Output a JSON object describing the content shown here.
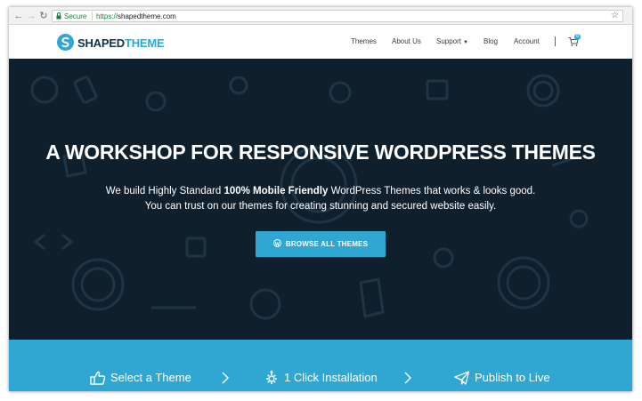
{
  "browser": {
    "secure_label": "Secure",
    "url_scheme": "https://",
    "url_host": "shapedtheme.com"
  },
  "header": {
    "logo_part1": "SHAPED",
    "logo_part2": "THEME",
    "menu": {
      "themes": "Themes",
      "about": "About Us",
      "support": "Support",
      "blog": "Blog",
      "account": "Account"
    },
    "cart_count": "0"
  },
  "hero": {
    "title": "A WORKSHOP FOR RESPONSIVE WORDPRESS THEMES",
    "sub_line1_pre": "We build Highly Standard ",
    "sub_line1_bold": "100% Mobile Friendly",
    "sub_line1_post": " WordPress Themes that works & looks good.",
    "sub_line2": "You can trust on our themes for creating stunning and secured website easily.",
    "button_label": "BROWSE ALL THEMES"
  },
  "steps": [
    {
      "label": "Select a Theme",
      "icon": "thumbs-up-icon"
    },
    {
      "label": "1 Click Installation",
      "icon": "gear-install-icon"
    },
    {
      "label": "Publish to Live",
      "icon": "paper-plane-icon"
    }
  ],
  "colors": {
    "accent": "#2fa7d2",
    "hero_bg": "#0f1f2c",
    "logo_dark": "#123046"
  }
}
